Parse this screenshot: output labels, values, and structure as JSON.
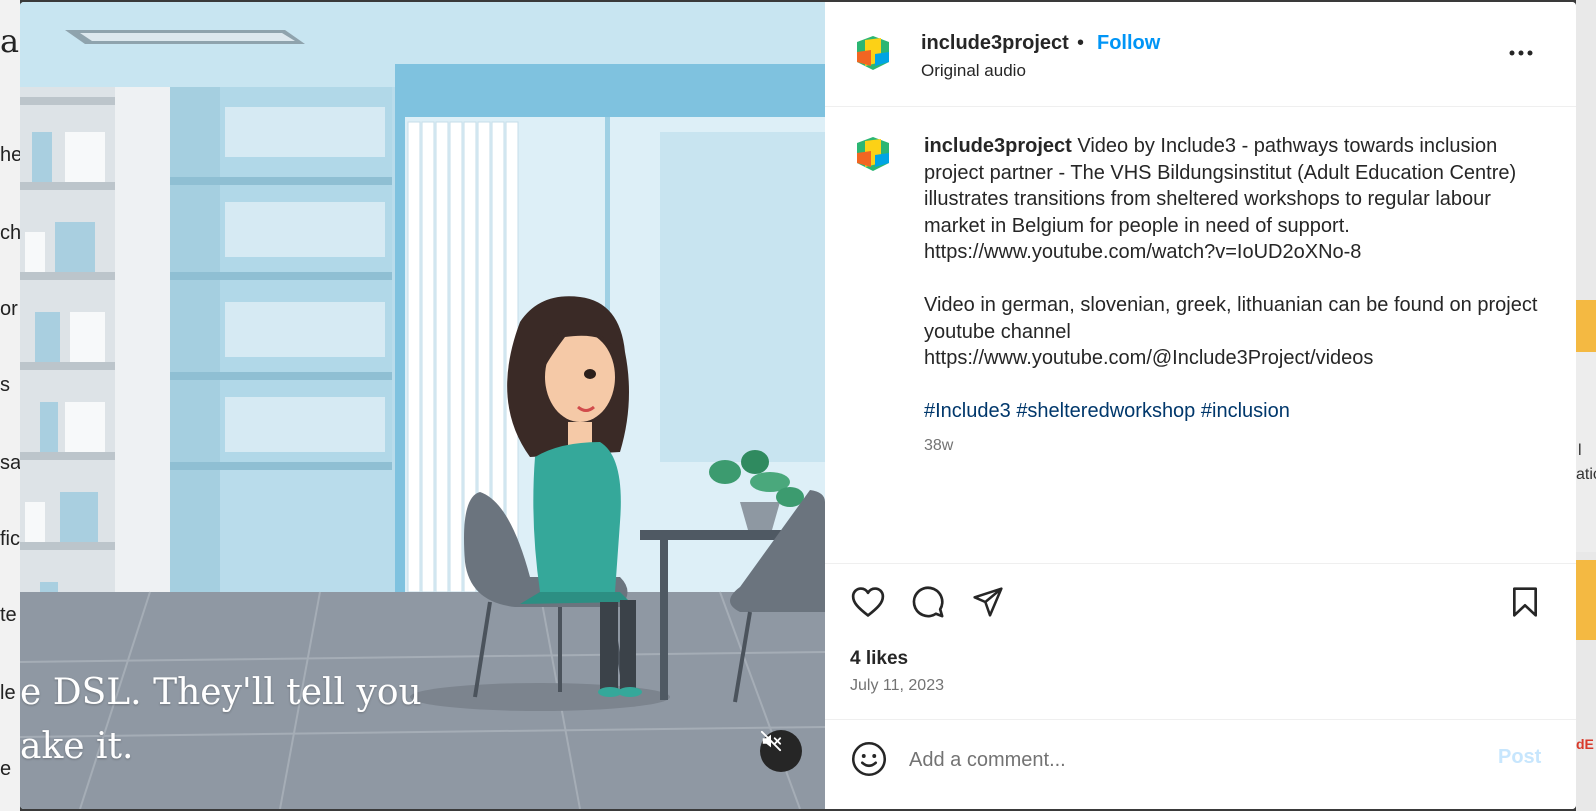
{
  "backdrop": {
    "left_fragments": [
      "a",
      "he",
      "ch",
      "or",
      "s",
      "sa",
      "fic",
      "te",
      "le",
      "e"
    ],
    "right_fragments": [
      "l",
      "atic",
      "dE"
    ]
  },
  "video": {
    "subtitle_line1": "e DSL. They'll tell you",
    "subtitle_line2": "ake it.",
    "mute_icon": "speaker-muted-icon"
  },
  "post_header": {
    "username": "include3project",
    "separator": "•",
    "follow_label": "Follow",
    "audio_label": "Original audio",
    "more_icon": "more-horizontal-icon"
  },
  "caption": {
    "username": "include3project",
    "text_p1": "Video by Include3 - pathways towards inclusion project partner - The VHS Bildungsinstitut (Adult Education Centre) illustrates transitions from sheltered workshops to regular labour market in Belgium for people in need of support.",
    "link1": "https://www.youtube.com/watch?v=IoUD2oXNo-8",
    "text_p2": "Video in german, slovenian, greek, lithuanian can be found on project youtube channel",
    "link2": "https://www.youtube.com/@Include3Project/videos",
    "hashtags": [
      "#Include3",
      "#shelteredworkshop",
      "#inclusion"
    ],
    "age": "38w"
  },
  "actions": {
    "icons": [
      "heart-icon",
      "comment-icon",
      "share-icon",
      "bookmark-icon"
    ],
    "likes": "4 likes",
    "date": "July 11, 2023"
  },
  "comment": {
    "placeholder": "Add a comment...",
    "post_label": "Post",
    "emoji_icon": "emoji-icon"
  },
  "colors": {
    "follow": "#0095f6",
    "hashtag": "#00376b",
    "post_disabled": "#c7e6fd",
    "muted_text": "#737373"
  }
}
